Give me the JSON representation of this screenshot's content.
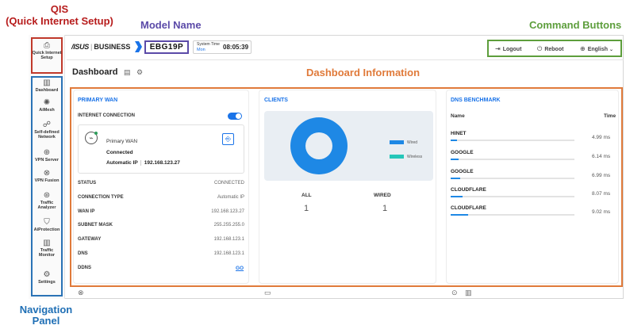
{
  "callouts": {
    "qis_line1": "QIS",
    "qis_line2": "(Quick Internet Setup)",
    "model": "Model Name",
    "commands": "Command Buttons",
    "dashboard": "Dashboard Information",
    "nav_line1": "Navigation",
    "nav_line2": "Panel"
  },
  "header": {
    "brand": "/ISUS",
    "brand_sep": "|",
    "brand_tier": "BUSINESS",
    "model": "EBG19P",
    "systime_label": "System Time",
    "systime_day": "Mon",
    "systime_clock": "08:05:39",
    "logout": "Logout",
    "reboot": "Reboot",
    "language": "English"
  },
  "sidebar": {
    "items": [
      {
        "label": "Quick Internet Setup",
        "icon": "qis-icon"
      },
      {
        "label": "Dashboard",
        "icon": "dashboard-icon"
      },
      {
        "label": "AiMesh",
        "icon": "aimesh-icon"
      },
      {
        "label": "Self-defined Network",
        "icon": "network-icon"
      },
      {
        "label": "VPN Server",
        "icon": "vpn-server-icon"
      },
      {
        "label": "VPN Fusion",
        "icon": "vpn-fusion-icon"
      },
      {
        "label": "Traffic Analyzer",
        "icon": "traffic-analyzer-icon"
      },
      {
        "label": "AiProtection",
        "icon": "aiprotection-icon"
      },
      {
        "label": "Traffic Monitor",
        "icon": "traffic-monitor-icon"
      },
      {
        "label": "Settings",
        "icon": "settings-icon"
      }
    ]
  },
  "dashboard": {
    "title": "Dashboard"
  },
  "primary_wan": {
    "title": "PRIMARY WAN",
    "internet_connection": "INTERNET CONNECTION",
    "wan_name": "Primary WAN",
    "wan_status": "Connected",
    "wan_ip_label": "Automatic IP",
    "wan_ip": "192.168.123.27",
    "rows": [
      {
        "label": "STATUS",
        "value": "CONNECTED"
      },
      {
        "label": "CONNECTION TYPE",
        "value": "Automatic IP"
      },
      {
        "label": "WAN IP",
        "value": "192.168.123.27"
      },
      {
        "label": "SUBNET MASK",
        "value": "255.255.255.0"
      },
      {
        "label": "GATEWAY",
        "value": "192.168.123.1"
      },
      {
        "label": "DNS",
        "value": "192.168.123.1"
      },
      {
        "label": "DDNS",
        "value": ""
      }
    ],
    "ddns_link": "GO"
  },
  "clients": {
    "title": "CLIENTS",
    "legend_wired": "Wired",
    "legend_wireless": "Wireless",
    "wired_color": "#1e88e5",
    "wireless_color": "#26c6b9",
    "all_label": "ALL",
    "wired_label": "WIRED",
    "all_count": "1",
    "wired_count": "1"
  },
  "dns_benchmark": {
    "title": "DNS BENCHMARK",
    "col_name": "Name",
    "col_time": "Time",
    "rows": [
      {
        "name": "HINET",
        "time": "4.99 ms",
        "fill": 0.02
      },
      {
        "name": "GOOGLE",
        "time": "6.14 ms",
        "fill": 0.04
      },
      {
        "name": "GOOGLE",
        "time": "6.99 ms",
        "fill": 0.05
      },
      {
        "name": "CLOUDFLARE",
        "time": "8.07 ms",
        "fill": 0.06
      },
      {
        "name": "CLOUDFLARE",
        "time": "9.02 ms",
        "fill": 0.09
      }
    ]
  }
}
